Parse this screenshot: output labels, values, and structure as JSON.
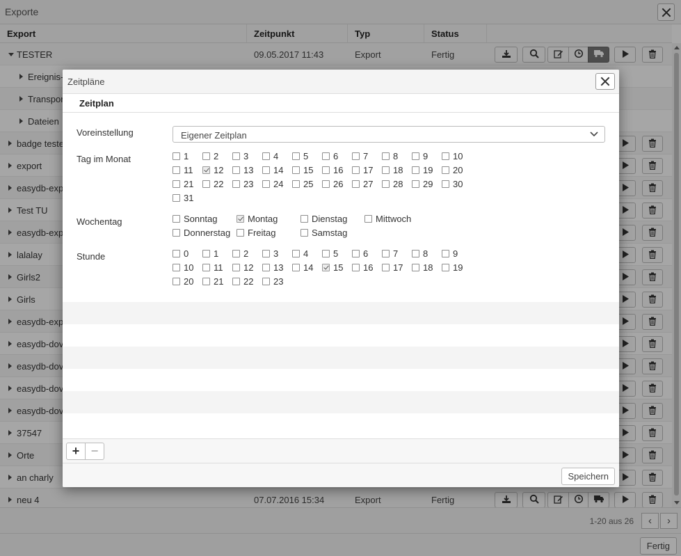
{
  "background": {
    "title": "Exporte",
    "columns": [
      "Export",
      "Zeitpunkt",
      "Typ",
      "Status"
    ],
    "rows": [
      {
        "name": "TESTER",
        "level": 0,
        "expanded": true,
        "time": "09.05.2017 11:43",
        "type": "Export",
        "status": "Fertig",
        "tools": true
      },
      {
        "name": "Ereignis-",
        "level": 1
      },
      {
        "name": "Transport",
        "level": 1
      },
      {
        "name": "Dateien",
        "level": 1
      },
      {
        "name": "badge teste",
        "level": 0,
        "tools": true
      },
      {
        "name": "export",
        "level": 0,
        "tools": true
      },
      {
        "name": "easydb-exp",
        "level": 0,
        "tools": true
      },
      {
        "name": "Test TU",
        "level": 0,
        "tools": true
      },
      {
        "name": "easydb-exp",
        "level": 0,
        "tools": true
      },
      {
        "name": "lalalay",
        "level": 0,
        "tools": true
      },
      {
        "name": "Girls2",
        "level": 0,
        "tools": true
      },
      {
        "name": "Girls",
        "level": 0,
        "tools": true
      },
      {
        "name": "easydb-exp",
        "level": 0,
        "tools": true
      },
      {
        "name": "easydb-dov",
        "level": 0,
        "tools": true
      },
      {
        "name": "easydb-dov",
        "level": 0,
        "tools": true
      },
      {
        "name": "easydb-dov",
        "level": 0,
        "tools": true
      },
      {
        "name": "easydb-dov",
        "level": 0,
        "tools": true
      },
      {
        "name": "37547",
        "level": 0,
        "tools": true
      },
      {
        "name": "Orte",
        "level": 0,
        "tools": true
      },
      {
        "name": "an charly",
        "level": 0,
        "tools": true
      },
      {
        "name": "neu 4",
        "level": 0,
        "time": "07.07.2016 15:34",
        "type": "Export",
        "status": "Fertig",
        "tools": true
      }
    ],
    "pager_text": "1-20 aus 26",
    "done_label": "Fertig"
  },
  "modal": {
    "title": "Zeitpläne",
    "tab": "Zeitplan",
    "preset_label": "Voreinstellung",
    "preset_value": "Eigener Zeitplan",
    "day_of_month_label": "Tag im Monat",
    "days_of_month": [
      "1",
      "2",
      "3",
      "4",
      "5",
      "6",
      "7",
      "8",
      "9",
      "10",
      "11",
      "12",
      "13",
      "14",
      "15",
      "16",
      "17",
      "18",
      "19",
      "20",
      "21",
      "22",
      "23",
      "24",
      "25",
      "26",
      "27",
      "28",
      "29",
      "30",
      "31"
    ],
    "days_of_month_checked": [
      "12"
    ],
    "weekday_label": "Wochentag",
    "weekdays": [
      "Sonntag",
      "Montag",
      "Dienstag",
      "Mittwoch",
      "Donnerstag",
      "Freitag",
      "Samstag"
    ],
    "weekdays_checked": [
      "Montag"
    ],
    "hour_label": "Stunde",
    "hours": [
      "0",
      "1",
      "2",
      "3",
      "4",
      "5",
      "6",
      "7",
      "8",
      "9",
      "10",
      "11",
      "12",
      "13",
      "14",
      "15",
      "16",
      "17",
      "18",
      "19",
      "20",
      "21",
      "22",
      "23"
    ],
    "hours_checked": [
      "15"
    ],
    "add_label": "+",
    "remove_label": "−",
    "save_label": "Speichern"
  },
  "colors": {
    "overlay": "rgba(0,0,0,0.35)",
    "active_tool": "#777777"
  },
  "icons": [
    "download-icon",
    "search-icon",
    "edit-icon",
    "clock-icon",
    "truck-icon",
    "play-icon",
    "trash-icon",
    "chevron-down-icon",
    "close-icon"
  ]
}
